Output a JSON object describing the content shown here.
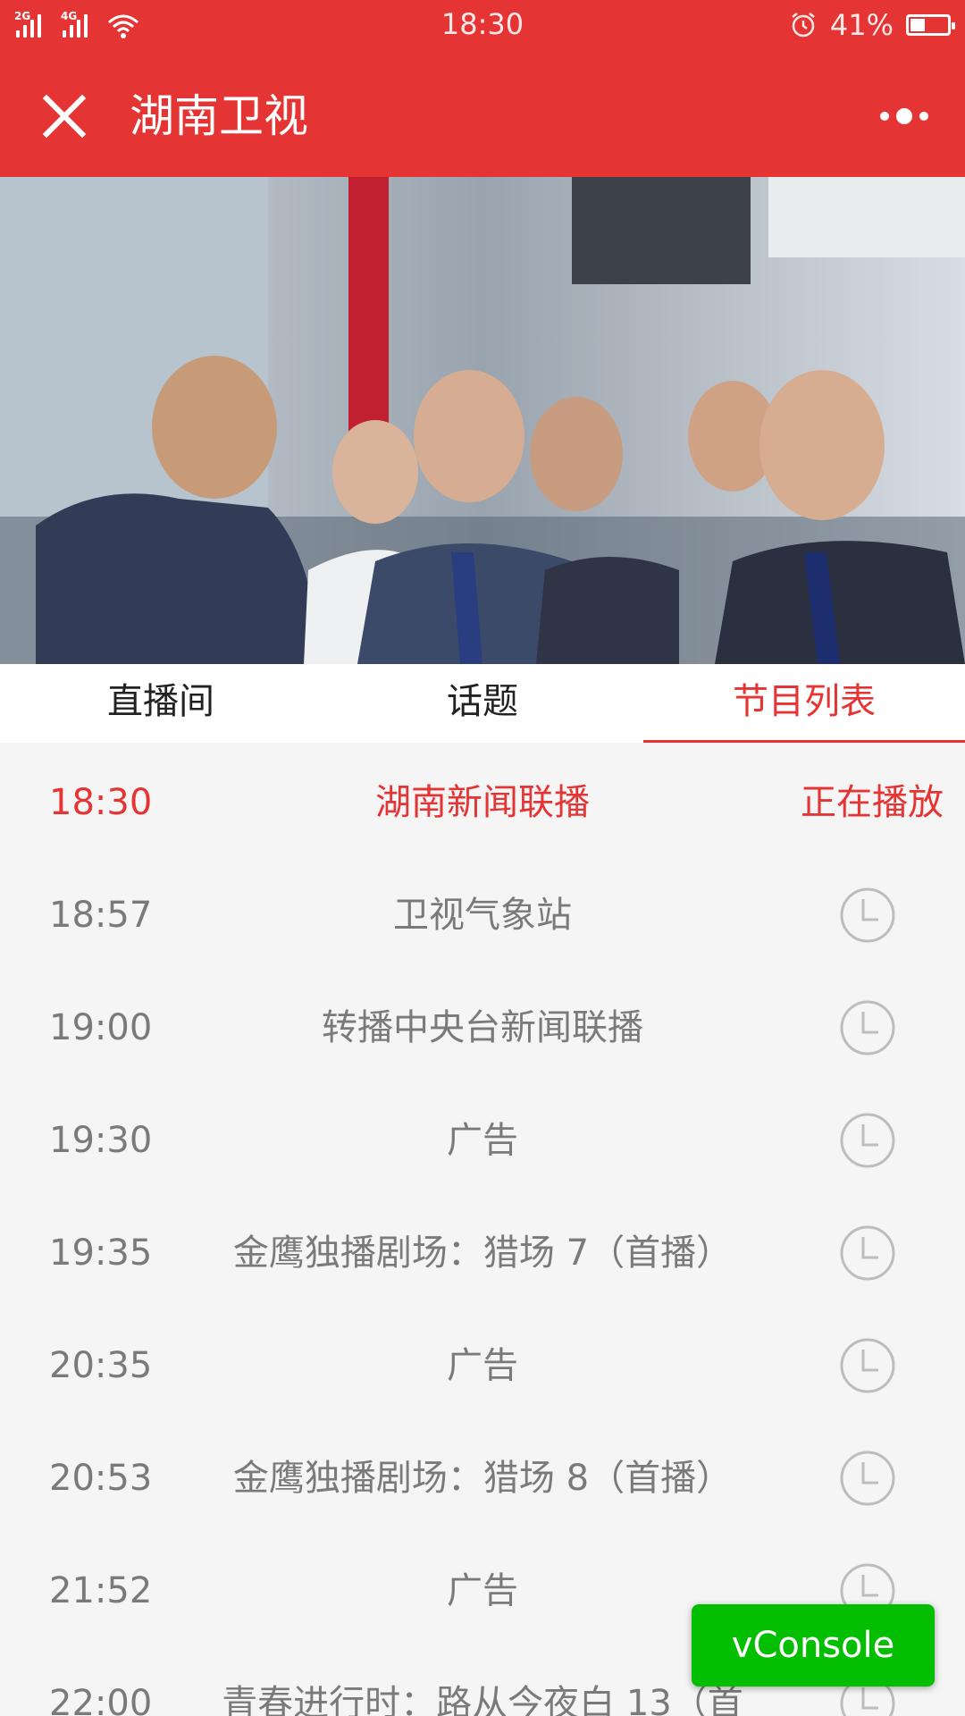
{
  "status_bar": {
    "net1": "2G",
    "net2": "4G",
    "time": "18:30",
    "battery_percent": "41%",
    "battery_level": 0.41,
    "icons": [
      "signal-icon",
      "wifi-icon",
      "alarm-icon",
      "battery-icon"
    ]
  },
  "header": {
    "title": "湖南卫视",
    "close_icon": "close-icon",
    "more_icon": "more-icon"
  },
  "tabs": [
    {
      "label": "直播间",
      "active": false
    },
    {
      "label": "话题",
      "active": false
    },
    {
      "label": "节目列表",
      "active": true
    }
  ],
  "schedule": [
    {
      "time": "18:30",
      "program": "湖南新闻联播",
      "status": "正在播放"
    },
    {
      "time": "18:57",
      "program": "卫视气象站",
      "status": ""
    },
    {
      "time": "19:00",
      "program": "转播中央台新闻联播",
      "status": ""
    },
    {
      "time": "19:30",
      "program": "广告",
      "status": ""
    },
    {
      "time": "19:35",
      "program": "金鹰独播剧场：猎场 7（首播）",
      "status": ""
    },
    {
      "time": "20:35",
      "program": "广告",
      "status": ""
    },
    {
      "time": "20:53",
      "program": "金鹰独播剧场：猎场 8（首播）",
      "status": ""
    },
    {
      "time": "21:52",
      "program": "广告",
      "status": ""
    },
    {
      "time": "22:00",
      "program": "青春进行时：路从今夜白 13（首",
      "status": ""
    }
  ],
  "vconsole": {
    "label": "vConsole"
  },
  "colors": {
    "accent": "#e53434",
    "vconsole": "#04be02",
    "list_bg": "#f5f5f5"
  }
}
